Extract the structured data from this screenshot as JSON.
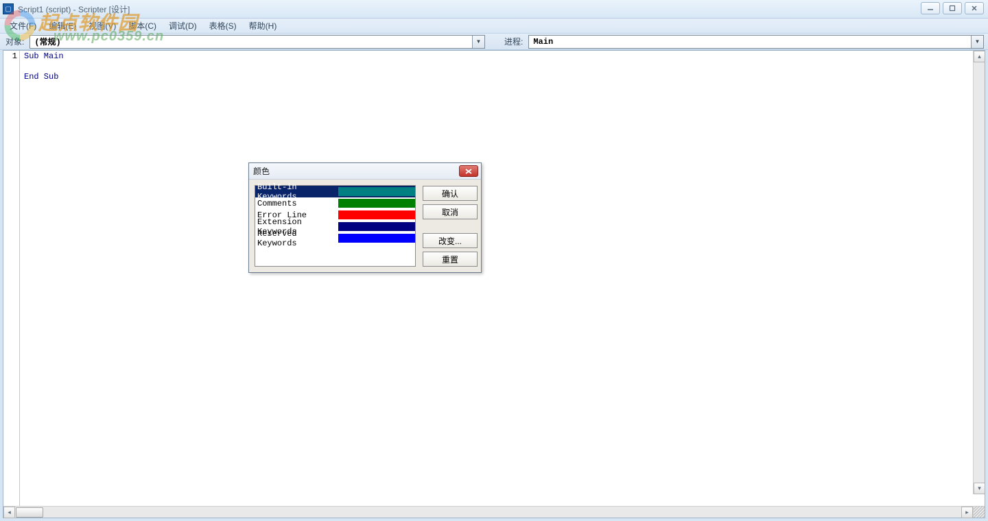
{
  "window": {
    "title": "Script1 (script) - Scripter [设计]"
  },
  "menu": {
    "items": [
      "文件(F)",
      "编辑(E)",
      "视图(V)",
      "脚本(C)",
      "调试(D)",
      "表格(S)",
      "帮助(H)"
    ]
  },
  "dropdowns": {
    "object_label": "对象:",
    "object_value": "(常规)",
    "proc_label": "进程:",
    "proc_value": "Main"
  },
  "editor": {
    "gutter": [
      "1"
    ],
    "lines": [
      "Sub Main",
      "",
      "End Sub"
    ]
  },
  "dialog": {
    "title": "颜色",
    "items": [
      {
        "name": "Built-in Keywords",
        "color": "#008080",
        "selected": true
      },
      {
        "name": "Comments",
        "color": "#008000",
        "selected": false
      },
      {
        "name": "Error Line",
        "color": "#ff0000",
        "selected": false
      },
      {
        "name": "Extension Keywords",
        "color": "#000080",
        "selected": false
      },
      {
        "name": "Reserved Keywords",
        "color": "#0000ff",
        "selected": false
      }
    ],
    "buttons": {
      "ok": "确认",
      "cancel": "取消",
      "change": "改变...",
      "reset": "重置"
    }
  },
  "watermark": {
    "text": "起点软件园",
    "url": "www.pc0359.cn"
  }
}
